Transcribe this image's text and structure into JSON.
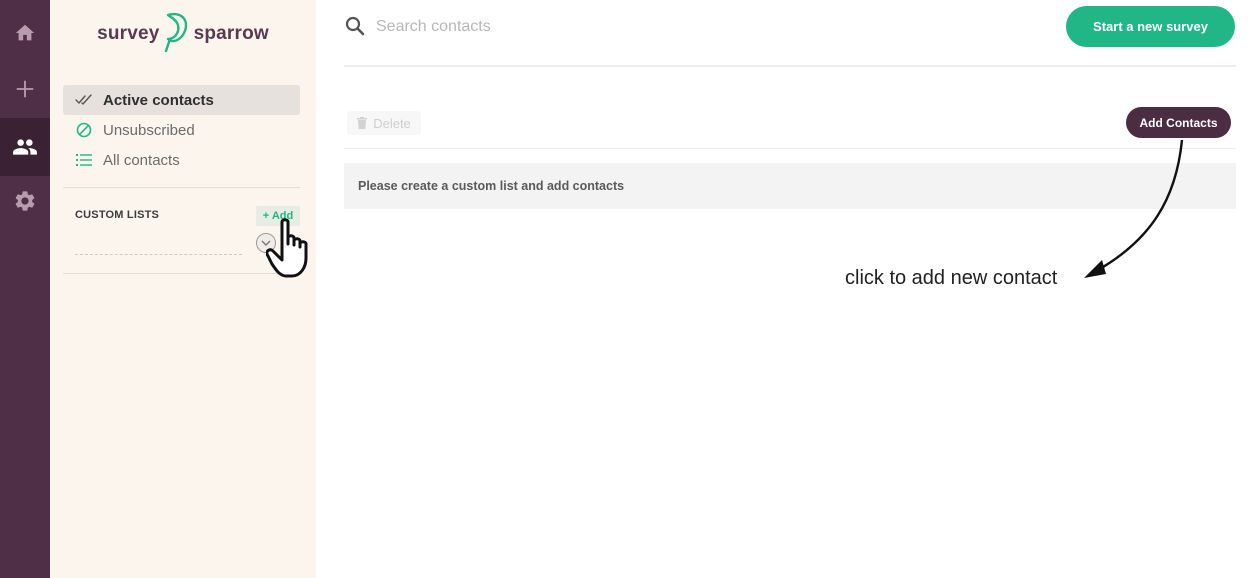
{
  "rail": {
    "items": [
      {
        "name": "home-icon",
        "active": false
      },
      {
        "name": "plus-icon",
        "active": false
      },
      {
        "name": "people-icon",
        "active": true
      },
      {
        "name": "gear-icon",
        "active": false
      }
    ]
  },
  "sidebar": {
    "logo": {
      "left": "survey",
      "right": "sparrow"
    },
    "nav": [
      {
        "label": "Active contacts",
        "icon": "double-check-icon",
        "active": true
      },
      {
        "label": "Unsubscribed",
        "icon": "blocked-circle-icon",
        "active": false
      },
      {
        "label": "All contacts",
        "icon": "list-icon",
        "active": false
      }
    ],
    "custom_lists": {
      "title": "CUSTOM LISTS",
      "add_label": "+ Add"
    }
  },
  "header": {
    "search": {
      "placeholder": "Search contacts",
      "value": ""
    },
    "start_survey_label": "Start a new survey"
  },
  "toolbar": {
    "delete_label": "Delete",
    "add_contacts_label": "Add Contacts"
  },
  "notice": {
    "text": "Please create a custom list and add contacts"
  },
  "annotation": {
    "text": "click to add new contact"
  },
  "colors": {
    "rail": "#4f2f47",
    "sidebar": "#fcf5ee",
    "accent_green": "#20b685",
    "add_contacts_bg": "#4a2d42"
  }
}
